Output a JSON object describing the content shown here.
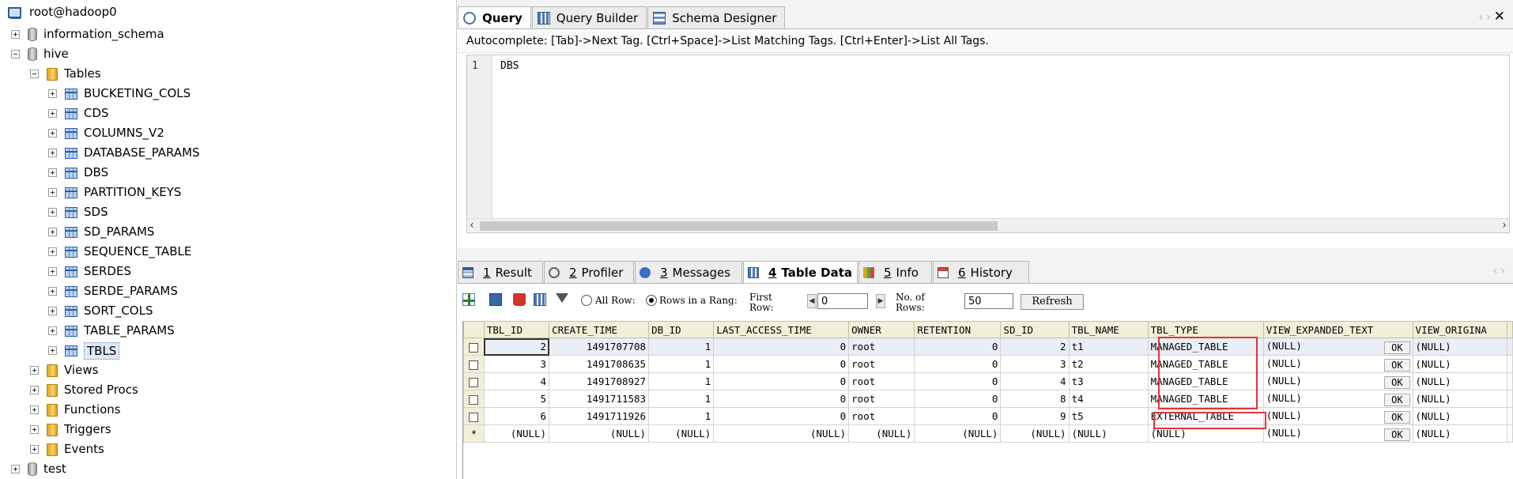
{
  "tree": {
    "connection": "root@hadoop0",
    "databases": {
      "information_schema": "information_schema",
      "hive": "hive",
      "test": "test"
    },
    "tables_folder": "Tables",
    "tables": [
      "BUCKETING_COLS",
      "CDS",
      "COLUMNS_V2",
      "DATABASE_PARAMS",
      "DBS",
      "PARTITION_KEYS",
      "SDS",
      "SD_PARAMS",
      "SEQUENCE_TABLE",
      "SERDES",
      "SERDE_PARAMS",
      "SORT_COLS",
      "TABLE_PARAMS",
      "TBLS"
    ],
    "selected_table": "TBLS",
    "folders": [
      "Views",
      "Stored Procs",
      "Functions",
      "Triggers",
      "Events"
    ]
  },
  "editor_tabs": [
    "Query",
    "Query Builder",
    "Schema Designer"
  ],
  "editor_tab_active": "Query",
  "autocomplete_hint": "Autocomplete: [Tab]->Next Tag. [Ctrl+Space]->List Matching Tags. [Ctrl+Enter]->List All Tags.",
  "editor": {
    "line_number": "1",
    "code": "DBS"
  },
  "result_tabs": [
    {
      "num": "1",
      "label": "Result"
    },
    {
      "num": "2",
      "label": "Profiler"
    },
    {
      "num": "3",
      "label": "Messages"
    },
    {
      "num": "4",
      "label": "Table Data"
    },
    {
      "num": "5",
      "label": "Info"
    },
    {
      "num": "6",
      "label": "History"
    }
  ],
  "result_tab_active": "Table Data",
  "toolbar": {
    "all_rows_label": "All Row:",
    "rows_in_range_label": "Rows in a Rang:",
    "first_row_label_1": "First",
    "first_row_label_2": "Row:",
    "first_row_value": "0",
    "no_of_rows_label_1": "No. of",
    "no_of_rows_label_2": "Rows:",
    "no_of_rows_value": "50",
    "refresh_label": "Refresh",
    "selected_option": "Rows in a Range"
  },
  "grid": {
    "columns": [
      "TBL_ID",
      "CREATE_TIME",
      "DB_ID",
      "LAST_ACCESS_TIME",
      "OWNER",
      "RETENTION",
      "SD_ID",
      "TBL_NAME",
      "TBL_TYPE",
      "VIEW_EXPANDED_TEXT",
      "VIEW_ORIGINA"
    ],
    "rows": [
      [
        "2",
        "1491707708",
        "1",
        "0",
        "root",
        "0",
        "2",
        "t1",
        "MANAGED_TABLE",
        "(NULL)",
        "(NULL)"
      ],
      [
        "3",
        "1491708635",
        "1",
        "0",
        "root",
        "0",
        "3",
        "t2",
        "MANAGED_TABLE",
        "(NULL)",
        "(NULL)"
      ],
      [
        "4",
        "1491708927",
        "1",
        "0",
        "root",
        "0",
        "4",
        "t3",
        "MANAGED_TABLE",
        "(NULL)",
        "(NULL)"
      ],
      [
        "5",
        "1491711583",
        "1",
        "0",
        "root",
        "0",
        "8",
        "t4",
        "MANAGED_TABLE",
        "(NULL)",
        "(NULL)"
      ],
      [
        "6",
        "1491711926",
        "1",
        "0",
        "root",
        "0",
        "9",
        "t5",
        "EXTERNAL_TABLE",
        "(NULL)",
        "(NULL)"
      ]
    ],
    "new_row": [
      "(NULL)",
      "(NULL)",
      "(NULL)",
      "(NULL)",
      "(NULL)",
      "(NULL)",
      "(NULL)",
      "(NULL)",
      "(NULL)",
      "(NULL)",
      "(NULL)"
    ],
    "new_row_marker": "*",
    "ok_label": "OK"
  },
  "colors": {
    "highlight": "#e0353a",
    "header_bg": "#f2efd9",
    "selected_row": "#e9eef7"
  }
}
